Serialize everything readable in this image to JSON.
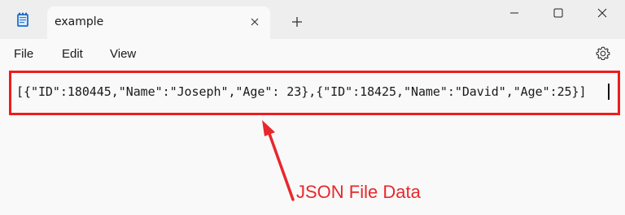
{
  "window": {
    "tab_title": "example",
    "app_icon": "notepad-icon",
    "new_tab_icon": "plus-icon",
    "controls": [
      "minimize-icon",
      "maximize-icon",
      "close-icon"
    ]
  },
  "menu": {
    "file": "File",
    "edit": "Edit",
    "view": "View",
    "settings_icon": "gear-icon"
  },
  "editor": {
    "content": "[{\"ID\":180445,\"Name\":\"Joseph\",\"Age\": 23},{\"ID\":18425,\"Name\":\"David\",\"Age\":25}]"
  },
  "annotation": {
    "label": "JSON File Data",
    "color": "#e8282b"
  }
}
